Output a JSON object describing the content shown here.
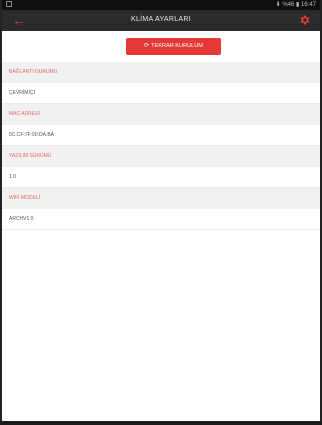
{
  "status_bar": {
    "right_text": "⬇ %46 ▮ 16:47"
  },
  "app_bar": {
    "title": "KLİMA AYARLARI",
    "back_icon": "arrow-left-icon",
    "settings_icon": "gear-icon",
    "accent": "#e53935"
  },
  "reset_button": {
    "icon": "refresh-icon",
    "label": "TEKRAR KURULUM"
  },
  "info": {
    "connection_label": "BAĞLANTI DURUMU",
    "connection_value": "ÇEVRİMİÇİ",
    "mac_label": "MAC ADRESİ",
    "mac_value": "5C:CF:7F:90:DA:BA",
    "software_label": "YAZILIM SÜRÜMÜ",
    "software_value": "1.0",
    "wifi_label": "WİFİ MODELİ",
    "wifi_value": "ARCHV1.0"
  }
}
